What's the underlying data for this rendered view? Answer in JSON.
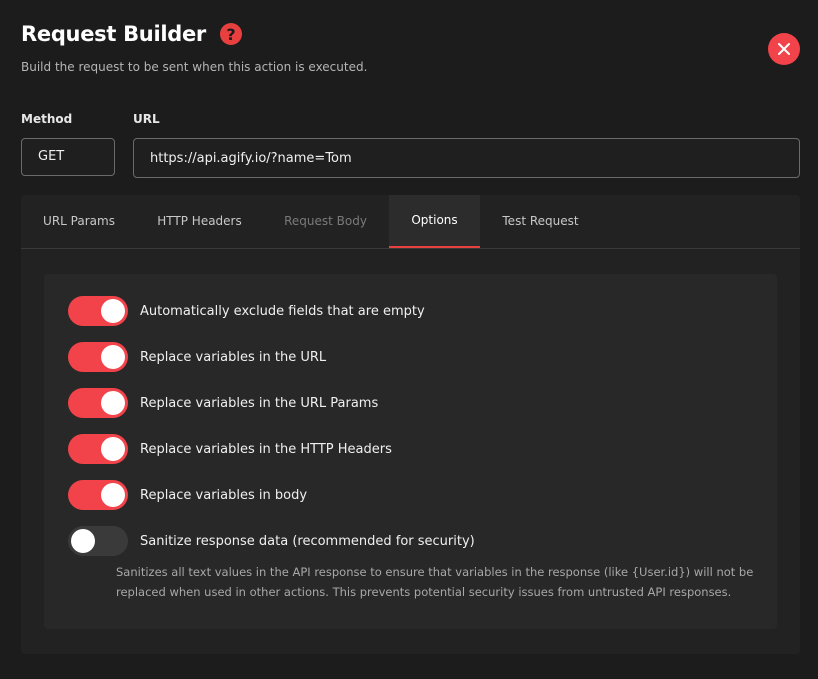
{
  "header": {
    "title": "Request Builder",
    "help_glyph": "?",
    "subtitle": "Build the request to be sent when this action is executed."
  },
  "form": {
    "method_label": "Method",
    "method_value": "GET",
    "url_label": "URL",
    "url_value": "https://api.agify.io/?name=Tom"
  },
  "tabs": [
    {
      "label": "URL Params",
      "state": "normal"
    },
    {
      "label": "HTTP Headers",
      "state": "normal"
    },
    {
      "label": "Request Body",
      "state": "disabled"
    },
    {
      "label": "Options",
      "state": "active"
    },
    {
      "label": "Test Request",
      "state": "normal"
    }
  ],
  "options": [
    {
      "label": "Automatically exclude fields that are empty",
      "enabled": true
    },
    {
      "label": "Replace variables in the URL",
      "enabled": true
    },
    {
      "label": "Replace variables in the URL Params",
      "enabled": true
    },
    {
      "label": "Replace variables in the HTTP Headers",
      "enabled": true
    },
    {
      "label": "Replace variables in body",
      "enabled": true
    },
    {
      "label": "Sanitize response data (recommended for security)",
      "enabled": false
    }
  ],
  "sanitize_description": "Sanitizes all text values in the API response to ensure that variables in the response (like {User.id}) will not be replaced when used in other actions. This prevents potential security issues from untrusted API responses.",
  "colors": {
    "accent": "#f2424a",
    "background": "#1c1c1c",
    "panel": "#222222"
  },
  "icons": {
    "help": "help-circle-icon",
    "close": "close-icon"
  }
}
